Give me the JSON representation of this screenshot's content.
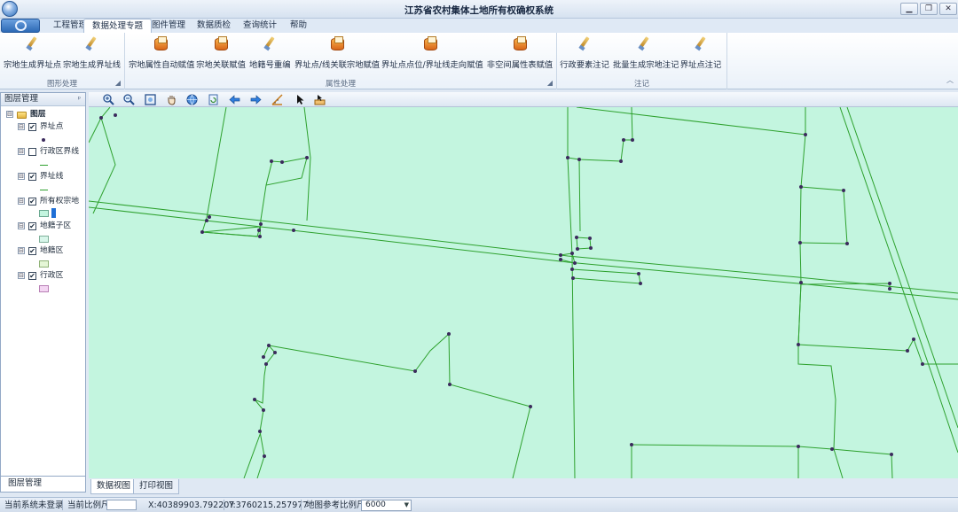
{
  "window": {
    "title": "江苏省农村集体土地所有权确权系统",
    "controls": {
      "minimize": "▁",
      "restore": "❐",
      "close": "✕"
    }
  },
  "ribbon": {
    "tabs": [
      {
        "label": "工程管理"
      },
      {
        "label": "数据处理专题",
        "active": true
      },
      {
        "label": "图件管理"
      },
      {
        "label": "数据质检"
      },
      {
        "label": "查询统计"
      },
      {
        "label": "帮助"
      }
    ],
    "groups": [
      {
        "label": "图形处理",
        "buttons": [
          {
            "label": "宗地生成界址点",
            "icon": "wand-icon"
          },
          {
            "label": "宗地生成界址线",
            "icon": "wand-icon"
          }
        ]
      },
      {
        "label": "属性处理",
        "buttons": [
          {
            "label": "宗地属性自动赋值",
            "icon": "database-icon"
          },
          {
            "label": "宗地关联赋值",
            "icon": "database-icon"
          },
          {
            "label": "地籍号重编",
            "icon": "wand-icon"
          },
          {
            "label": "界址点/线关联宗地赋值",
            "icon": "database-icon"
          },
          {
            "label": "界址点点位/界址线走向赋值",
            "icon": "database-icon"
          },
          {
            "label": "非空间属性表赋值",
            "icon": "database-icon"
          }
        ]
      },
      {
        "label": "注记",
        "buttons": [
          {
            "label": "行政要素注记",
            "icon": "wand-icon"
          },
          {
            "label": "批量生成宗地注记",
            "icon": "wand-icon"
          },
          {
            "label": "界址点注记",
            "icon": "wand-icon"
          }
        ]
      }
    ]
  },
  "layer_panel": {
    "title": "图层管理",
    "pin": "ᵖ",
    "root": {
      "label": "图层",
      "expand": "⊟"
    },
    "layers": [
      {
        "label": "界址点",
        "checked": "✔",
        "expand": "⊟"
      },
      {
        "label": "行政区界线",
        "checked": "",
        "expand": "⊟"
      },
      {
        "label": "界址线",
        "checked": "✔",
        "expand": "⊟"
      },
      {
        "label": "所有权宗地",
        "checked": "✔",
        "expand": "⊟"
      },
      {
        "label": "地籍子区",
        "checked": "✔",
        "expand": "⊟"
      },
      {
        "label": "地籍区",
        "checked": "✔",
        "expand": "⊟"
      },
      {
        "label": "行政区",
        "checked": "✔",
        "expand": "⊟"
      }
    ],
    "bottom_tab": "图层管理"
  },
  "map_toolbar": {
    "tools": [
      "zoom-in-icon",
      "zoom-out-icon",
      "full-extent-icon",
      "pan-hand-icon",
      "globe-icon",
      "refresh-icon",
      "back-arrow-icon",
      "forward-arrow-icon",
      "measure-icon",
      "select-pointer-icon",
      "identify-icon"
    ]
  },
  "map": {
    "background_color": "#c3f5df",
    "line_color": "#2ea12e",
    "point_color": "#3b2a5c"
  },
  "view_tabs": [
    {
      "label": "数据视图",
      "active": true
    },
    {
      "label": "打印视图"
    }
  ],
  "status": {
    "login": "当前系统未登录",
    "scale_label": "当前比例尺",
    "x": "X:40389903.792207",
    "y": "Y:3760215.257977",
    "ref_scale_label": "地图参考比例尺:",
    "ref_scale_value": "6000",
    "dropdown": "▼"
  }
}
